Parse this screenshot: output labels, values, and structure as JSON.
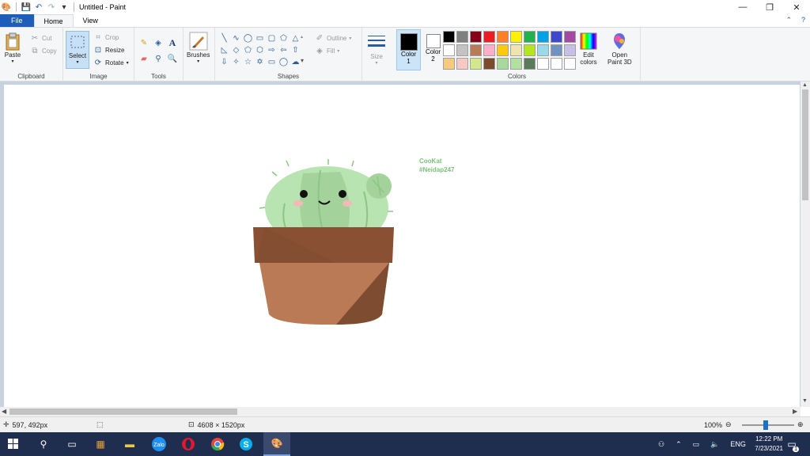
{
  "window": {
    "title": "Untitled - Paint",
    "quick_access": [
      "save-icon",
      "undo-icon",
      "redo-icon",
      "customize-icon"
    ]
  },
  "tabs": {
    "file": "File",
    "home": "Home",
    "view": "View"
  },
  "ribbon": {
    "clipboard": {
      "label": "Clipboard",
      "paste": "Paste",
      "cut": "Cut",
      "copy": "Copy"
    },
    "image": {
      "label": "Image",
      "select": "Select",
      "crop": "Crop",
      "resize": "Resize",
      "rotate": "Rotate"
    },
    "tools": {
      "label": "Tools"
    },
    "brushes": {
      "label": "Brushes"
    },
    "shapes": {
      "label": "Shapes",
      "outline": "Outline",
      "fill": "Fill"
    },
    "size": {
      "label": "Size"
    },
    "colors": {
      "label": "Colors",
      "color1": "Color 1",
      "color1_line1": "Color",
      "color1_line2": "1",
      "color2": "Color 2",
      "color2_line1": "Color",
      "color2_line2": "2",
      "color1_value": "#000000",
      "color2_value": "#ffffff",
      "edit_colors_line1": "Edit",
      "edit_colors_line2": "colors",
      "palette": [
        "#000000",
        "#7f7f7f",
        "#880015",
        "#ed1c24",
        "#ff7f27",
        "#fff200",
        "#22b14c",
        "#00a2e8",
        "#3f48cc",
        "#a349a4",
        "#ffffff",
        "#c3c3c3",
        "#b97a57",
        "#ffaec9",
        "#ffc90e",
        "#efe4b0",
        "#b5e61d",
        "#99d9ea",
        "#7092be",
        "#c8bfe7",
        "#f9c97d",
        "#f7c9c5",
        "#d3e88a",
        "#7a4a2c",
        "#a7d99a",
        "#b3e0a1",
        "#5a7a5a",
        "#ffffff",
        "#ffffff",
        "#ffffff"
      ]
    },
    "paint3d": {
      "line1": "Open",
      "line2": "Paint 3D"
    }
  },
  "canvas": {
    "credit_line1": "CooKat",
    "credit_line2": "#Neidap247"
  },
  "statusbar": {
    "cursor_pos": "597, 492px",
    "image_size": "4608 × 1520px",
    "zoom": "100%"
  },
  "taskbar": {
    "lang": "ENG",
    "time": "12:22 PM",
    "date": "7/23/2021",
    "notification_count": "1"
  }
}
